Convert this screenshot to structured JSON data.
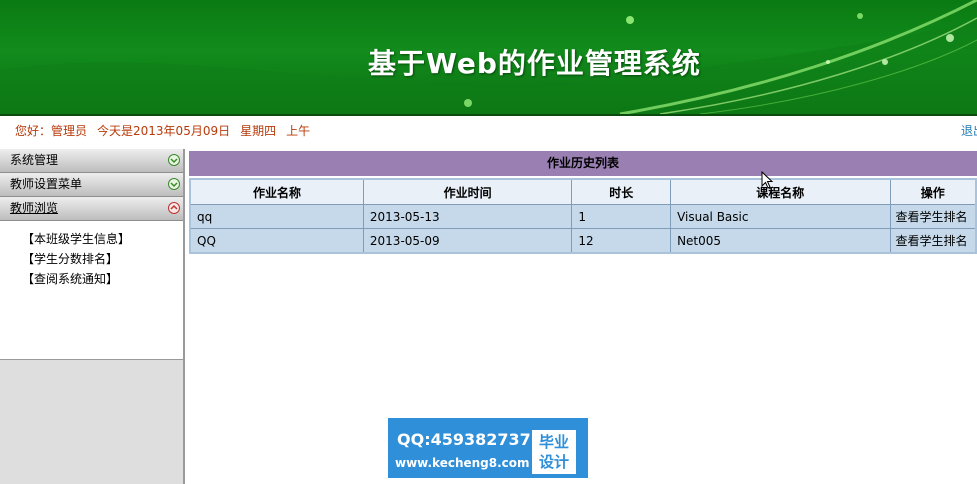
{
  "banner": {
    "title": "基于Web的作业管理系统"
  },
  "infobar": {
    "greeting": "您好：管理员",
    "date": "今天是2013年05月09日",
    "weekday": "星期四",
    "ampm": "上午",
    "logout": "退出"
  },
  "sidebar": {
    "menus": [
      {
        "label": "系统管理"
      },
      {
        "label": "教师设置菜单"
      },
      {
        "label": "教师浏览"
      }
    ],
    "items": [
      {
        "label": "【本班级学生信息】"
      },
      {
        "label": "【学生分数排名】"
      },
      {
        "label": "【查阅系统通知】"
      }
    ]
  },
  "list": {
    "title": "作业历史列表",
    "columns": [
      "作业名称",
      "作业时间",
      "时长",
      "课程名称",
      "操作"
    ],
    "rows": [
      {
        "name": "qq",
        "time": "2013-05-13",
        "duration": "1",
        "course": "Visual Basic",
        "action": "查看学生排名"
      },
      {
        "name": "QQ",
        "time": "2013-05-09",
        "duration": "12",
        "course": "Net005",
        "action": "查看学生排名"
      }
    ]
  },
  "watermark": {
    "qq": "QQ:459382737",
    "site": "www.kecheng8.com",
    "tag_line1": "毕业",
    "tag_line2": "设计"
  },
  "colors": {
    "banner": "#128c1c",
    "list_title": "#9a7fb3",
    "row": "#c5d9ea",
    "greeting": "#b83a0a"
  }
}
